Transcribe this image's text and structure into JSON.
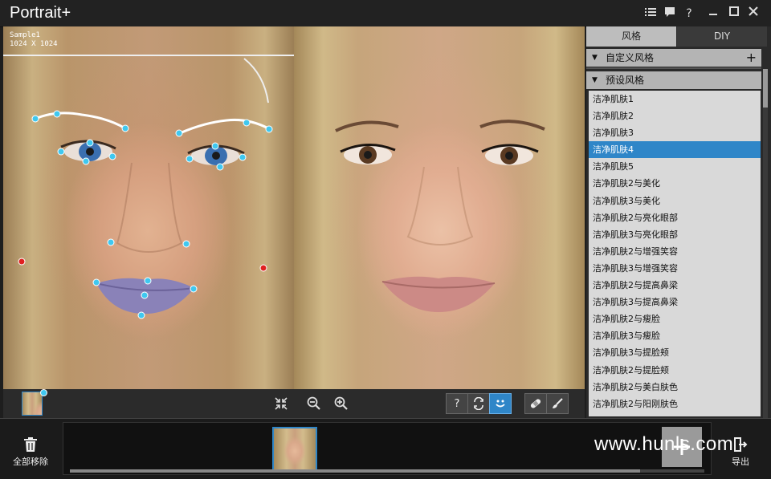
{
  "app": {
    "title": "Portrait+"
  },
  "window_controls": {
    "menu_icon": "list-icon",
    "chat_icon": "chat-icon",
    "help_label": "?",
    "minimize_icon": "minimize-icon",
    "maximize_icon": "maximize-icon",
    "close_icon": "close-icon"
  },
  "viewer": {
    "sample_label": "Sample1\n1024 X 1024"
  },
  "toolbar": {
    "help_label": "?"
  },
  "panel": {
    "tabs": [
      {
        "label": "风格"
      },
      {
        "label": "DIY"
      }
    ],
    "custom_section": "自定义风格",
    "preset_section": "预设风格",
    "presets": [
      "洁净肌肤1",
      "洁净肌肤2",
      "洁净肌肤3",
      "洁净肌肤4",
      "洁净肌肤5",
      "洁净肌肤2与美化",
      "洁净肌肤3与美化",
      "洁净肌肤2与亮化眼部",
      "洁净肌肤3与亮化眼部",
      "洁净肌肤2与增强笑容",
      "洁净肌肤3与增强笑容",
      "洁净肌肤2与提高鼻梁",
      "洁净肌肤3与提高鼻梁",
      "洁净肌肤2与瘦脸",
      "洁净肌肤3与瘦脸",
      "洁净肌肤3与提脸颊",
      "洁净肌肤2与提脸颊",
      "洁净肌肤2与美白肤色",
      "洁净肌肤2与阳刚肤色"
    ],
    "selected_preset": "洁净肌肤4"
  },
  "footer": {
    "remove_all_label": "全部移除",
    "export_label": "导出"
  },
  "watermark": "www.hunls.com",
  "colors": {
    "accent": "#2f86c8",
    "landmark": "#3fc8f0",
    "landmark_warn": "#e02020"
  }
}
